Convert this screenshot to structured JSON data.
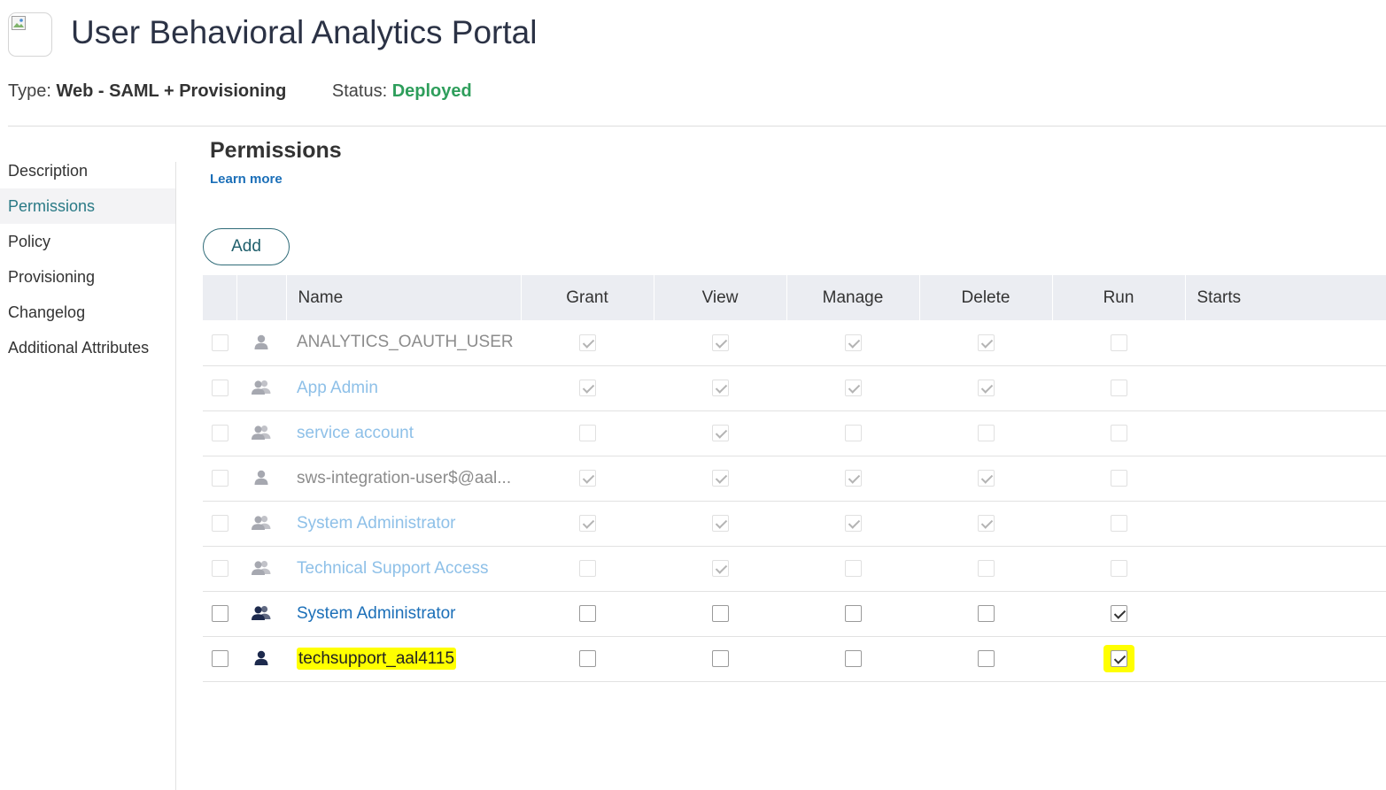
{
  "header": {
    "title": "User Behavioral Analytics Portal",
    "type_label": "Type:",
    "type_value": "Web - SAML + Provisioning",
    "status_label": "Status:",
    "status_value": "Deployed"
  },
  "sidebar": {
    "items": [
      {
        "label": "Description",
        "active": false
      },
      {
        "label": "Permissions",
        "active": true
      },
      {
        "label": "Policy",
        "active": false
      },
      {
        "label": "Provisioning",
        "active": false
      },
      {
        "label": "Changelog",
        "active": false
      },
      {
        "label": "Additional Attributes",
        "active": false
      }
    ]
  },
  "permissions": {
    "title": "Permissions",
    "learn_more": "Learn more",
    "add_label": "Add",
    "columns": [
      "Name",
      "Grant",
      "View",
      "Manage",
      "Delete",
      "Run",
      "Starts"
    ],
    "rows": [
      {
        "name": "ANALYTICS_OAUTH_USER",
        "kind": "user",
        "style": "gray",
        "disabled": true,
        "grant": true,
        "view": true,
        "manage": true,
        "delete": true,
        "run": false,
        "highlight": false
      },
      {
        "name": "App Admin",
        "kind": "group",
        "style": "lightblue",
        "disabled": true,
        "grant": true,
        "view": true,
        "manage": true,
        "delete": true,
        "run": false,
        "highlight": false
      },
      {
        "name": "service account",
        "kind": "group",
        "style": "lightblue",
        "disabled": true,
        "grant": false,
        "view": true,
        "manage": false,
        "delete": false,
        "run": false,
        "highlight": false
      },
      {
        "name": "sws-integration-user$@aal...",
        "kind": "user",
        "style": "gray",
        "disabled": true,
        "grant": true,
        "view": true,
        "manage": true,
        "delete": true,
        "run": false,
        "highlight": false
      },
      {
        "name": "System Administrator",
        "kind": "group",
        "style": "lightblue",
        "disabled": true,
        "grant": true,
        "view": true,
        "manage": true,
        "delete": true,
        "run": false,
        "highlight": false
      },
      {
        "name": "Technical Support Access",
        "kind": "group",
        "style": "lightblue",
        "disabled": true,
        "grant": false,
        "view": true,
        "manage": false,
        "delete": false,
        "run": false,
        "highlight": false
      },
      {
        "name": "System Administrator",
        "kind": "group",
        "style": "blue",
        "disabled": false,
        "grant": false,
        "view": false,
        "manage": false,
        "delete": false,
        "run": true,
        "highlight": false
      },
      {
        "name": "techsupport_aal4115",
        "kind": "user",
        "style": "dark",
        "disabled": false,
        "grant": false,
        "view": false,
        "manage": false,
        "delete": false,
        "run": true,
        "highlight": true
      }
    ]
  },
  "colors": {
    "status": "#2e9e5b",
    "link": "#1b6fb8",
    "accent": "#2a7a86",
    "highlight": "#ffff00",
    "header_bg": "#ebedf2"
  },
  "icons": {
    "user": "user-icon",
    "group": "group-icon",
    "broken_image": "broken-image-icon"
  }
}
